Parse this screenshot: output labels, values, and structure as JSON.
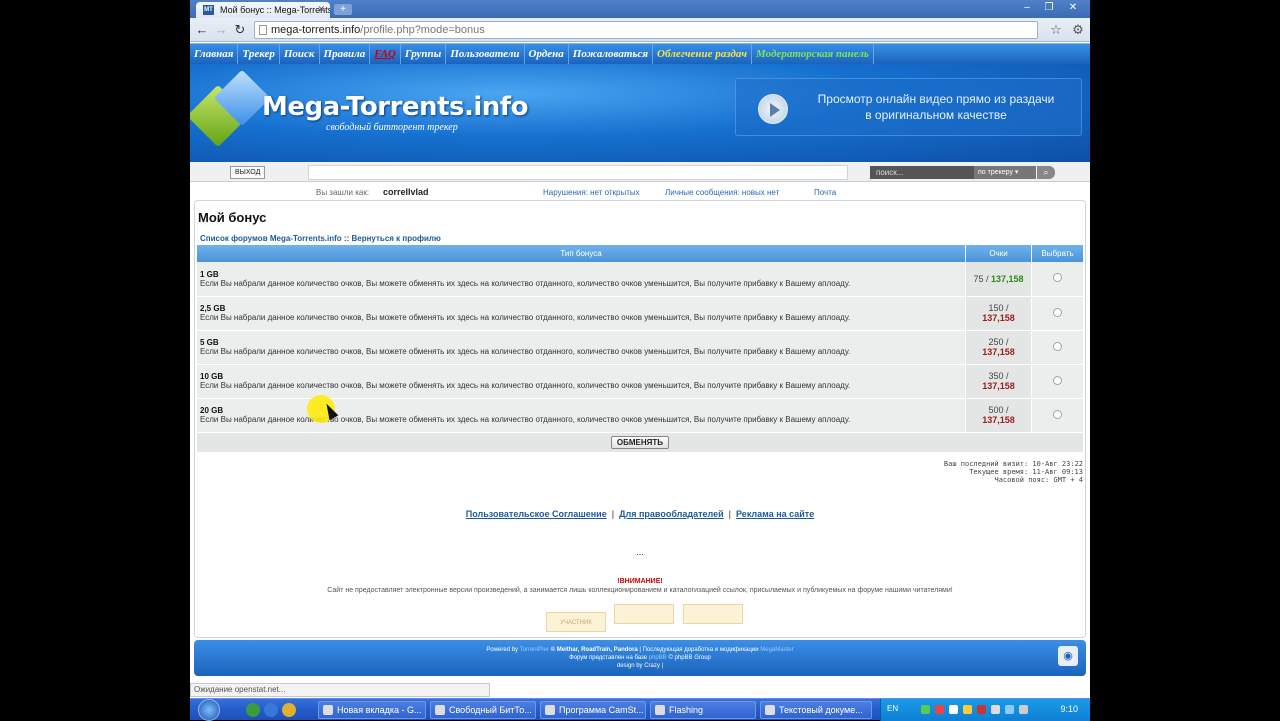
{
  "browser": {
    "tab_title": "Мой бонус :: Mega-Torrents.info",
    "tab_favicon": "MT",
    "url_host": "mega-torrents.info",
    "url_path": "/profile.php?mode=bonus"
  },
  "sitenav": {
    "items": [
      "Главная",
      "Трекер",
      "Поиск",
      "Правила",
      "FAQ",
      "Группы",
      "Пользователи",
      "Ордена",
      "Пожаловаться",
      "Облегчение раздач",
      "Модераторская панель"
    ]
  },
  "banner": {
    "logo": "Mega-Torrents.info",
    "slogan": "свободный битторент трекер",
    "promo_line1": "Просмотр онлайн видео прямо из раздачи",
    "promo_line2": "в оригинальном качестве"
  },
  "strip": {
    "logout": "ВЫХОД",
    "search_placeholder": "поиск...",
    "search_scope": "по трекеру"
  },
  "userinfo": {
    "logged_as": "Вы зашли как:",
    "username": "correllvlad",
    "violations": "Нарушения: нет открытых",
    "messages": "Личные сообщения: новых нет",
    "mail": "Почта"
  },
  "page": {
    "title": "Мой бонус",
    "crumb_forums": "Список форумов Mega-Torrents.info",
    "crumb_sep": "::",
    "crumb_back": "Вернуться к профилю",
    "col_type": "Тип бонуса",
    "col_points": "Очки",
    "col_select": "Выбрать",
    "exchange": "ОБМЕНЯТЬ",
    "rows": [
      {
        "gb": "1 GB",
        "text": "Если Вы набрали данное количество очков, Вы можете обменять их здесь на количество отданного, количество очков уменьшится, Вы получите прибавку к Вашему аплоаду.",
        "cost": "75",
        "current": "137,158",
        "enough": true
      },
      {
        "gb": "2,5 GB",
        "text": "Если Вы набрали данное количество очков, Вы можете обменять их здесь на количество отданного, количество очков уменьшится, Вы получите прибавку к Вашему аплоаду.",
        "cost": "150",
        "current": "137,158",
        "enough": false
      },
      {
        "gb": "5 GB",
        "text": "Если Вы набрали данное количество очков, Вы можете обменять их здесь на количество отданного, количество очков уменьшится, Вы получите прибавку к Вашему аплоаду.",
        "cost": "250",
        "current": "137,158",
        "enough": false
      },
      {
        "gb": "10 GB",
        "text": "Если Вы набрали данное количество очков, Вы можете обменять их здесь на количество отданного, количество очков уменьшится, Вы получите прибавку к Вашему аплоаду.",
        "cost": "350",
        "current": "137,158",
        "enough": false
      },
      {
        "gb": "20 GB",
        "text": "Если Вы набрали данное количество очков, Вы можете обменять их здесь на количество отданного, количество очков уменьшится, Вы получите прибавку к Вашему аплоаду.",
        "cost": "500",
        "current": "137,158",
        "enough": false
      }
    ],
    "visit_last": "Ваш последний визит: 10-Авг 23:22",
    "visit_now": "Текущее время: 11-Авг 09:13",
    "timezone": "Часовой пояс: GMT + 4",
    "link_agreement": "Пользовательское Соглашение",
    "link_holders": "Для правообладателей",
    "link_ads": "Реклама на сайте",
    "link_sep": "|",
    "dots": "...",
    "warn_title": "!ВНИМАНИЕ!",
    "warn_text": "Сайт не предоставляет электронные версии произведений, а занимается лишь коллекционированием и каталогизацией ссылок, присылаемых и публикуемых на форуме нашими читателями!",
    "counters": [
      "УЧАСТНИК",
      "",
      ""
    ]
  },
  "footer": {
    "powered": "Powered by",
    "tp": "TorrentPier",
    "authors": "© Meithar, RoadTrain, Pandora",
    "mod_text": "| Последующая доработка и модификации",
    "mod_author": "MegaMaster",
    "forum_text": "Форум представлен на базе",
    "phpbb": "phpBB",
    "phpbb_group": "© phpBB Group",
    "design": "design by Crazy |"
  },
  "statusbar": "Ожидание openstat.net...",
  "taskbar": {
    "tasks": [
      "Новая вкладка - G...",
      "Свободный БитТо...",
      "Программа CamSt...",
      "Flashing",
      "Текстовый докуме..."
    ],
    "lang": "EN",
    "clock": "9:10"
  }
}
